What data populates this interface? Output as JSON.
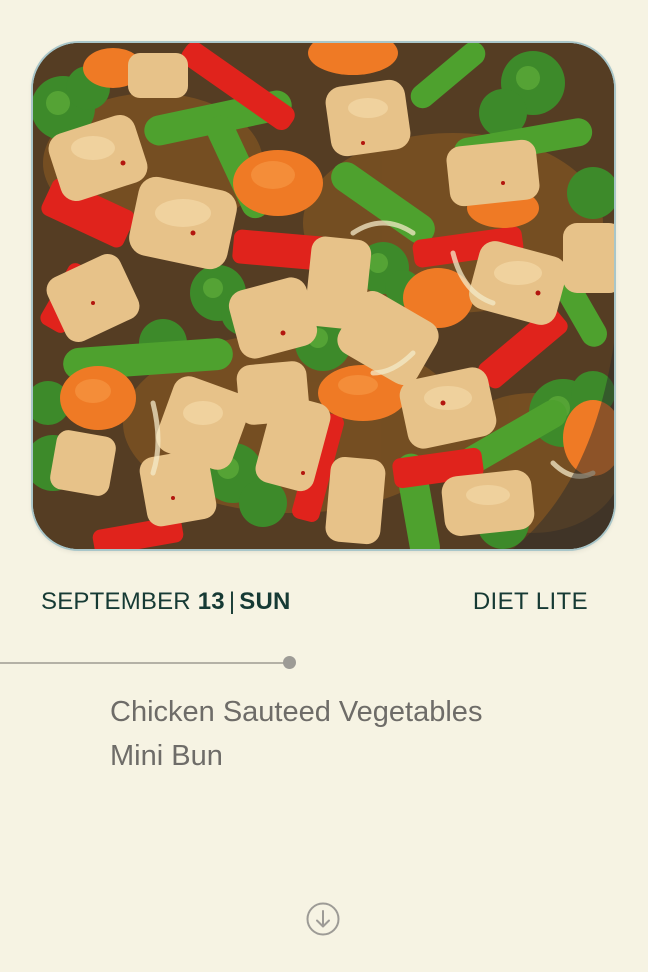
{
  "meal_card": {
    "image_alt": "Chicken stir-fry with vegetables",
    "date": {
      "month": "SEPTEMBER",
      "day": "13",
      "separator": "|",
      "weekday": "SUN"
    },
    "plan_name": "DIET LITE",
    "items": [
      "Chicken Sauteed Vegetables",
      "Mini Bun"
    ]
  },
  "icons": {
    "scroll_down": "arrow-down-circle-icon"
  },
  "colors": {
    "background": "#f6f3e3",
    "accent_text": "#163a34",
    "muted_text": "#6e6c68"
  }
}
